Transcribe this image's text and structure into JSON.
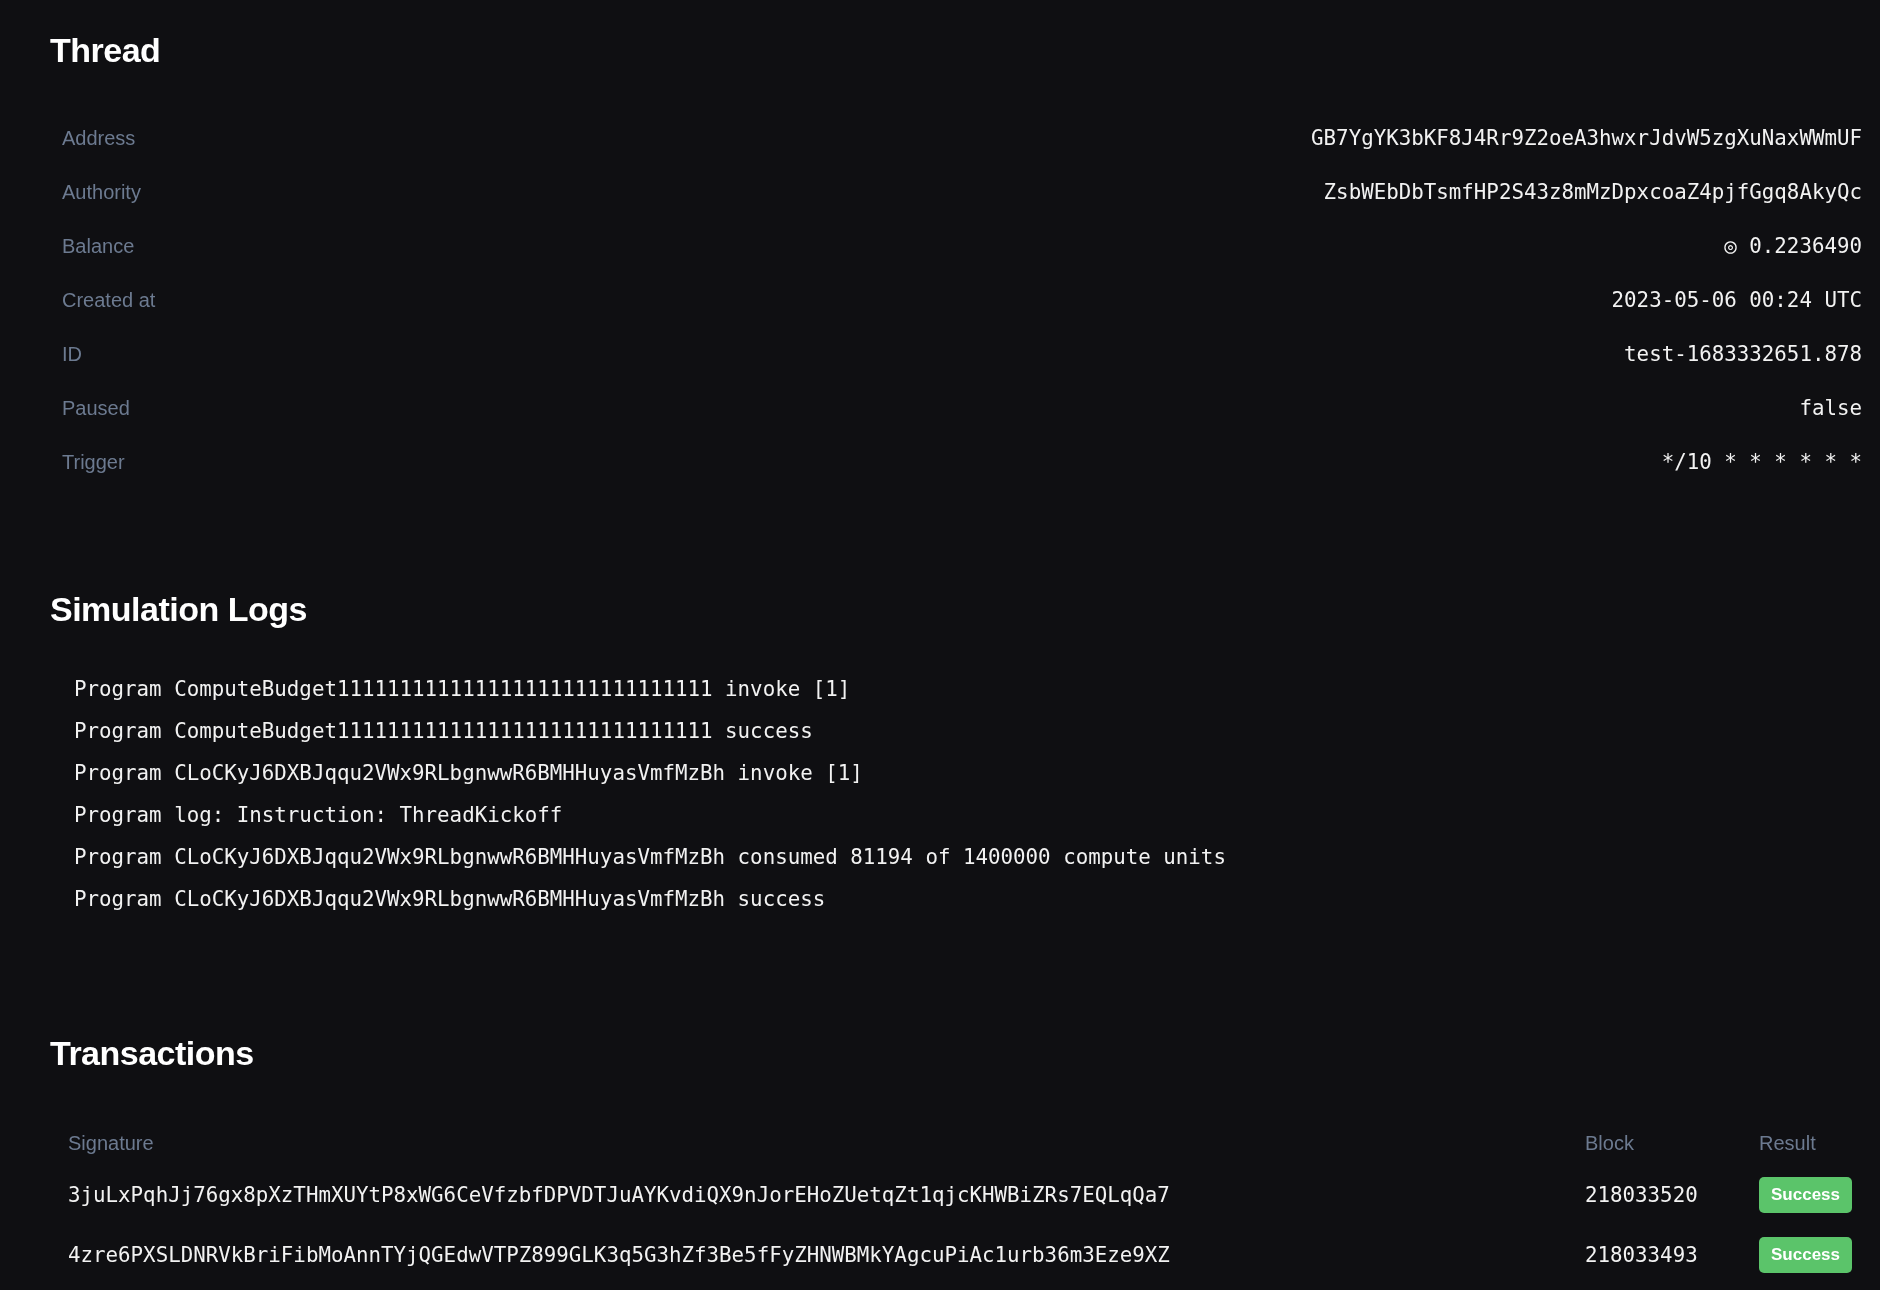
{
  "thread": {
    "title": "Thread",
    "fields": [
      {
        "label": "Address",
        "value": "GB7YgYK3bKF8J4Rr9Z2oeA3hwxrJdvW5zgXuNaxWWmUF"
      },
      {
        "label": "Authority",
        "value": "ZsbWEbDbTsmfHP2S43z8mMzDpxcoaZ4pjfGgq8AkyQc"
      },
      {
        "label": "Balance",
        "value": "◎ 0.2236490"
      },
      {
        "label": "Created at",
        "value": "2023-05-06 00:24 UTC"
      },
      {
        "label": "ID",
        "value": "test-1683332651.878"
      },
      {
        "label": "Paused",
        "value": "false"
      },
      {
        "label": "Trigger",
        "value": "*/10 * * * * * *"
      }
    ]
  },
  "simulation_logs": {
    "title": "Simulation Logs",
    "lines": [
      "Program ComputeBudget111111111111111111111111111111 invoke [1]",
      "Program ComputeBudget111111111111111111111111111111 success",
      "Program CLoCKyJ6DXBJqqu2VWx9RLbgnwwR6BMHHuyasVmfMzBh invoke [1]",
      "Program log: Instruction: ThreadKickoff",
      "Program CLoCKyJ6DXBJqqu2VWx9RLbgnwwR6BMHHuyasVmfMzBh consumed 81194 of 1400000 compute units",
      "Program CLoCKyJ6DXBJqqu2VWx9RLbgnwwR6BMHHuyasVmfMzBh success"
    ]
  },
  "transactions": {
    "title": "Transactions",
    "columns": [
      "Signature",
      "Block",
      "Result"
    ],
    "rows": [
      {
        "signature": "3juLxPqhJj76gx8pXzTHmXUYtP8xWG6CeVfzbfDPVDTJuAYKvdiQX9nJorEHoZUetqZt1qjcKHWBiZRs7EQLqQa7",
        "block": "218033520",
        "result": {
          "label": "Success",
          "color": "#5bc46a"
        }
      },
      {
        "signature": "4zre6PXSLDNRVkBriFibMoAnnTYjQGEdwVTPZ899GLK3q5G3hZf3Be5fFyZHNWBMkYAgcuPiAc1urb36m3Eze9XZ",
        "block": "218033493",
        "result": {
          "label": "Success",
          "color": "#5bc46a"
        }
      }
    ]
  }
}
